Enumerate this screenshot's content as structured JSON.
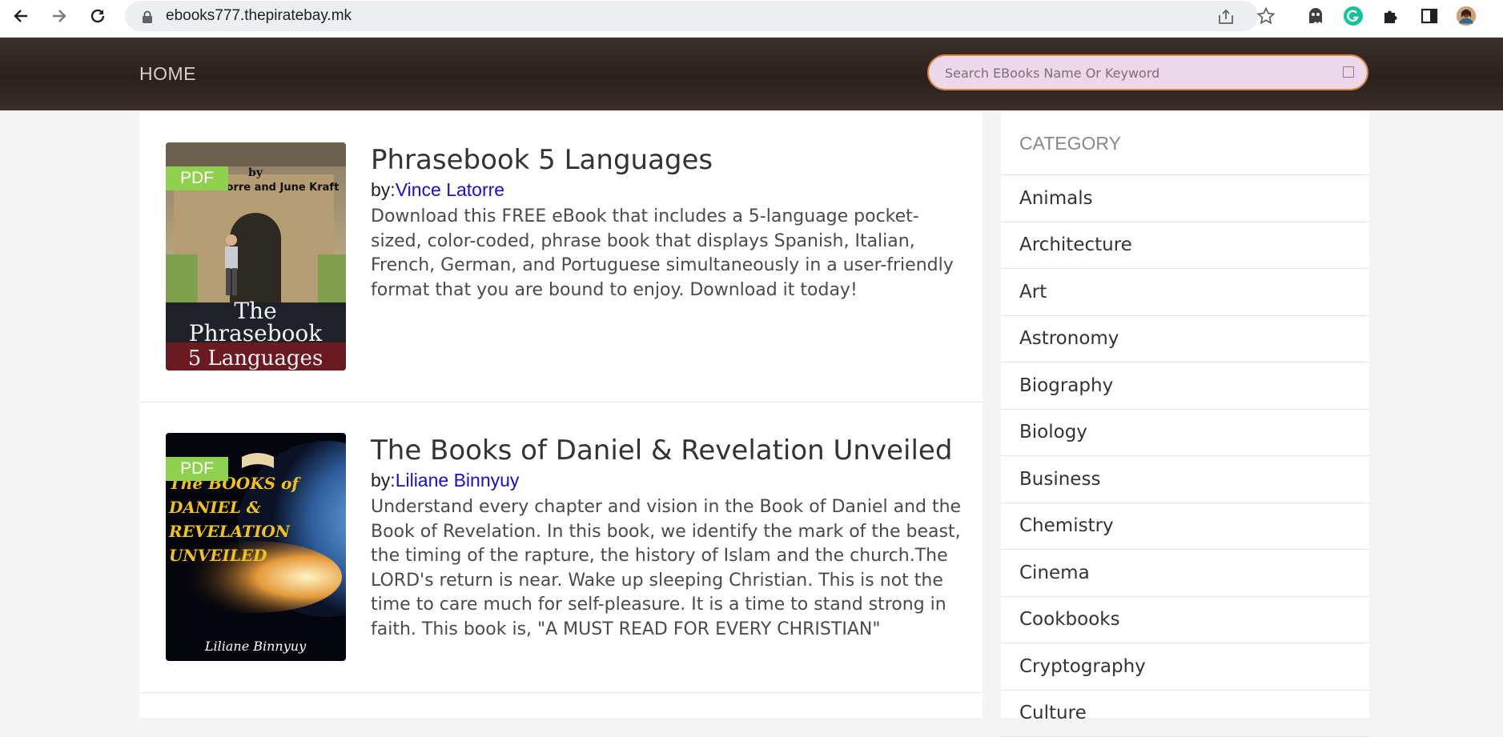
{
  "browser": {
    "url": "ebooks777.thepiratebay.mk",
    "back_icon": "arrow-left-icon",
    "forward_icon": "arrow-right-icon",
    "reload_icon": "reload-icon"
  },
  "header": {
    "home_label": "HOME",
    "search_placeholder": "Search EBooks Name Or Keyword"
  },
  "books": [
    {
      "title": "Phrasebook 5 Languages",
      "by_prefix": "by:",
      "author": "Vince Latorre",
      "badge": "PDF",
      "description": "Download this FREE eBook that includes a 5-language pocket-sized, color-coded, phrase book that displays Spanish, Italian, French, German, and Portuguese simultaneously in a user-friendly format that you are bound to enjoy. Download it today!",
      "cover": {
        "top_text_1": "by",
        "top_text_2": "Vince Latorre and June Kraft",
        "line1": "The",
        "line2": "Phrasebook",
        "line3": "5 Languages"
      }
    },
    {
      "title": "The Books of Daniel & Revelation Unveiled",
      "by_prefix": "by:",
      "author": "Liliane Binnyuy",
      "badge": "PDF",
      "description": "Understand every chapter and vision in the Book of Daniel and the Book of Revelation. In this book, we identify the mark of the beast, the timing of the rapture, the history of Islam and the church.The LORD's return is near. Wake up sleeping Christian. This is not the time to care much for self-pleasure. It is a time to stand strong in faith. This book is, \"A MUST READ FOR EVERY CHRISTIAN\"",
      "cover": {
        "line1": "The BOOKS of",
        "line2": "DANIEL  &",
        "line3": "REVELATION",
        "line4": "UNVEILED",
        "author": "Liliane Binnyuy"
      }
    }
  ],
  "sidebar": {
    "heading": "CATEGORY",
    "categories": [
      "Animals",
      "Architecture",
      "Art",
      "Astronomy",
      "Biography",
      "Biology",
      "Business",
      "Chemistry",
      "Cinema",
      "Cookbooks",
      "Cryptography",
      "Culture"
    ]
  },
  "colors": {
    "header_bg": "#2a211d",
    "search_border": "#d9843e",
    "search_bg": "#ecd8e8",
    "pdf_badge": "#8fd14f",
    "author_link": "#1a0dcc"
  }
}
